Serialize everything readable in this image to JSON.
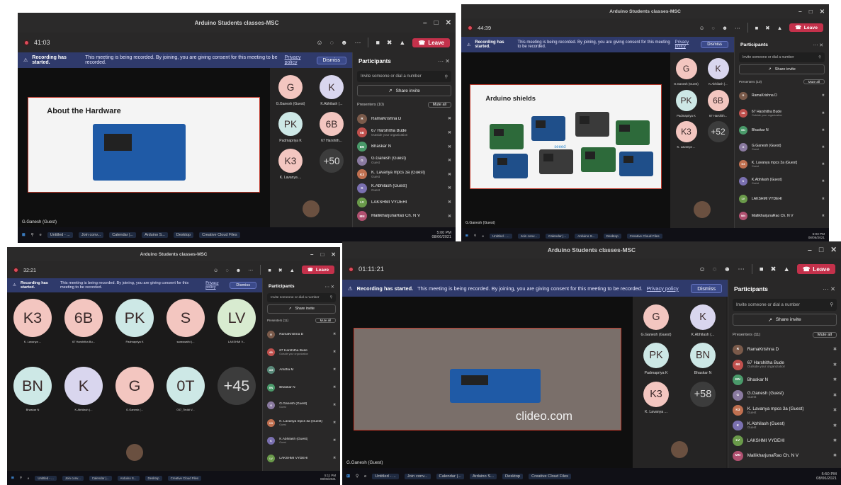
{
  "colors": {
    "leave": "#c4314b",
    "banner": "#2f3a6b",
    "panel": "#292828",
    "stage": "#0f0f0f"
  },
  "meeting": {
    "title": "Arduino Students classes-MSC",
    "leave_label": "Leave",
    "dismiss_label": "Dismiss",
    "banner_bold": "Recording has started.",
    "banner_text": "This meeting is being recorded. By joining, you are giving consent for this meeting to be recorded.",
    "privacy_link": "Privacy policy"
  },
  "panel": {
    "title": "Participants",
    "invite_placeholder": "Invite someone or dial a number",
    "share_label": "Share invite",
    "mute_all": "Mute all"
  },
  "taskbar": {
    "items": [
      "Untitled - ...",
      "Join conv...",
      "Calendar |...",
      "Arduino S...",
      "Desktop",
      "Creative Cloud Files"
    ]
  },
  "shots": [
    {
      "timer": "41:03",
      "stage_name": "G.Ganesh (Guest)",
      "slide_title": "About the Hardware",
      "presenters": "Presenters (10)",
      "clock_time": "5:00 PM",
      "clock_date": "08/06/2021",
      "tiles": [
        {
          "initials": "G",
          "name": "G.Ganesh (Guest)",
          "color": "#f3c6c0"
        },
        {
          "initials": "K",
          "name": "K.Abhilash (...",
          "color": "#d9d6ee"
        },
        {
          "initials": "PK",
          "name": "Padmapriya K",
          "color": "#cde8e6"
        },
        {
          "initials": "6B",
          "name": "67 Harshith...",
          "color": "#f3c6c0"
        },
        {
          "initials": "K3",
          "name": "K. Lavanya ...",
          "color": "#f3c6c0"
        },
        {
          "initials": "+50",
          "name": "",
          "color": "#3c3c3c"
        }
      ],
      "participants": [
        {
          "name": "RamaKrishna D",
          "sub": "",
          "initials": "R",
          "color": "#7a5a4a"
        },
        {
          "name": "67 Harshitha Bude",
          "sub": "Outside your organization",
          "initials": "6B",
          "color": "#c0504d"
        },
        {
          "name": "Bhaskar N",
          "sub": "",
          "initials": "BN",
          "color": "#4a9a6a"
        },
        {
          "name": "G.Ganesh (Guest)",
          "sub": "Guest",
          "initials": "G",
          "color": "#8a7aa0"
        },
        {
          "name": "K. Lavanya mpcs 3a (Guest)",
          "sub": "Guest",
          "initials": "K3",
          "color": "#c07050"
        },
        {
          "name": "K.Abhilash (Guest)",
          "sub": "Guest",
          "initials": "K",
          "color": "#7a70b0"
        },
        {
          "name": "LAKSHMI VYDEHI",
          "sub": "",
          "initials": "LV",
          "color": "#6a9a4a"
        },
        {
          "name": "MallikharjunaRao Ch. N V",
          "sub": "",
          "initials": "MN",
          "color": "#b05070"
        }
      ]
    },
    {
      "timer": "44:39",
      "stage_name": "G.Ganesh (Guest)",
      "slide_title": "Arduino shields",
      "seeed_label": "seeed",
      "presenters": "Presenters (10)",
      "clock_time": "5:03 PM",
      "clock_date": "08/06/2021",
      "tiles": [
        {
          "initials": "G",
          "name": "G.Ganesh (Guest)",
          "color": "#f3c6c0"
        },
        {
          "initials": "K",
          "name": "K.Abhilash (...",
          "color": "#d9d6ee"
        },
        {
          "initials": "PK",
          "name": "Padmapriya K",
          "color": "#cde8e6"
        },
        {
          "initials": "6B",
          "name": "67 Harshith...",
          "color": "#f3c6c0"
        },
        {
          "initials": "K3",
          "name": "K. Lavanya ...",
          "color": "#f3c6c0"
        },
        {
          "initials": "+52",
          "name": "",
          "color": "#3c3c3c"
        }
      ],
      "participants": [
        {
          "name": "RamaKrishna D",
          "sub": "",
          "initials": "R",
          "color": "#7a5a4a"
        },
        {
          "name": "67 Harshitha Bude",
          "sub": "Outside your organization",
          "initials": "6B",
          "color": "#c0504d"
        },
        {
          "name": "Bhaskar N",
          "sub": "",
          "initials": "BN",
          "color": "#4a9a6a"
        },
        {
          "name": "G.Ganesh (Guest)",
          "sub": "Guest",
          "initials": "G",
          "color": "#8a7aa0"
        },
        {
          "name": "K. Lavanya mpcs 3a (Guest)",
          "sub": "Guest",
          "initials": "K3",
          "color": "#c07050"
        },
        {
          "name": "K.Abhilash (Guest)",
          "sub": "Guest",
          "initials": "K",
          "color": "#7a70b0"
        },
        {
          "name": "LAKSHMI VYDEHI",
          "sub": "",
          "initials": "LV",
          "color": "#6a9a4a"
        },
        {
          "name": "MallikharjunaRao Ch. N V",
          "sub": "",
          "initials": "MN",
          "color": "#b05070"
        }
      ]
    },
    {
      "timer": "32:21",
      "presenters": "Presenters (11)",
      "clock_time": "5:11 PM",
      "clock_date": "08/06/2021",
      "tiles": [
        {
          "initials": "K3",
          "name": "K. Lavanya ...",
          "color": "#f3c6c0"
        },
        {
          "initials": "6B",
          "name": "67 Harshitha Bu...",
          "color": "#f3c6c0"
        },
        {
          "initials": "PK",
          "name": "Padmapriya K",
          "color": "#cde8e6"
        },
        {
          "initials": "S",
          "name": "saraswathi (...",
          "color": "#f3c6c0"
        },
        {
          "initials": "LV",
          "name": "LAKSHMI V...",
          "color": "#d8ebd0"
        },
        {
          "initials": "BN",
          "name": "Bhaskar N",
          "color": "#cde8e6"
        },
        {
          "initials": "K",
          "name": "K.Abhilash (...",
          "color": "#d9d6ee"
        },
        {
          "initials": "G",
          "name": "G.Ganesh (...",
          "color": "#f3c6c0"
        },
        {
          "initials": "0T",
          "name": "037_Teddi V...",
          "color": "#cde8e6"
        },
        {
          "initials": "+45",
          "name": "",
          "color": "#3c3c3c"
        }
      ],
      "participants": [
        {
          "name": "RamaKrishna D",
          "sub": "",
          "initials": "R",
          "color": "#7a5a4a"
        },
        {
          "name": "67 Harshitha Bude",
          "sub": "Outside your organization",
          "initials": "6B",
          "color": "#c0504d"
        },
        {
          "name": "Amitha M",
          "sub": "",
          "initials": "AM",
          "color": "#5a8a7a"
        },
        {
          "name": "Bhaskar N",
          "sub": "",
          "initials": "BN",
          "color": "#4a9a6a"
        },
        {
          "name": "G.Ganesh (Guest)",
          "sub": "Guest",
          "initials": "G",
          "color": "#8a7aa0"
        },
        {
          "name": "K. Lavanya mpcs 3a (Guest)",
          "sub": "Guest",
          "initials": "K3",
          "color": "#c07050"
        },
        {
          "name": "K.Abhilash (Guest)",
          "sub": "Guest",
          "initials": "K",
          "color": "#7a70b0"
        },
        {
          "name": "LAKSHMI VYDEHI",
          "sub": "",
          "initials": "LV",
          "color": "#6a9a4a"
        }
      ]
    },
    {
      "timer": "01:11:21",
      "stage_name": "G.Ganesh (Guest)",
      "watermark": "clideo.com",
      "presenters": "Presenters (11)",
      "clock_time": "5:50 PM",
      "clock_date": "08/06/2021",
      "tiles": [
        {
          "initials": "G",
          "name": "G.Ganesh (Guest)",
          "color": "#f3c6c0"
        },
        {
          "initials": "K",
          "name": "K.Abhilash (...",
          "color": "#d9d6ee"
        },
        {
          "initials": "PK",
          "name": "Padmapriya K",
          "color": "#cde8e6"
        },
        {
          "initials": "BN",
          "name": "Bhaskar N",
          "color": "#cde8e6"
        },
        {
          "initials": "K3",
          "name": "K. Lavanya ...",
          "color": "#f3c6c0"
        },
        {
          "initials": "+58",
          "name": "",
          "color": "#3c3c3c"
        }
      ],
      "participants": [
        {
          "name": "RamaKrishna D",
          "sub": "",
          "initials": "R",
          "color": "#7a5a4a"
        },
        {
          "name": "67 Harshitha Bude",
          "sub": "Outside your organization",
          "initials": "6B",
          "color": "#c0504d"
        },
        {
          "name": "Bhaskar N",
          "sub": "",
          "initials": "BN",
          "color": "#4a9a6a"
        },
        {
          "name": "G.Ganesh (Guest)",
          "sub": "Guest",
          "initials": "G",
          "color": "#8a7aa0"
        },
        {
          "name": "K. Lavanya mpcs 3a (Guest)",
          "sub": "Guest",
          "initials": "K3",
          "color": "#c07050"
        },
        {
          "name": "K.Abhilash (Guest)",
          "sub": "Guest",
          "initials": "K",
          "color": "#7a70b0"
        },
        {
          "name": "LAKSHMI VYDEHI",
          "sub": "",
          "initials": "LV",
          "color": "#6a9a4a"
        },
        {
          "name": "MallikharjunaRao Ch. N V",
          "sub": "",
          "initials": "MN",
          "color": "#b05070"
        }
      ]
    }
  ]
}
